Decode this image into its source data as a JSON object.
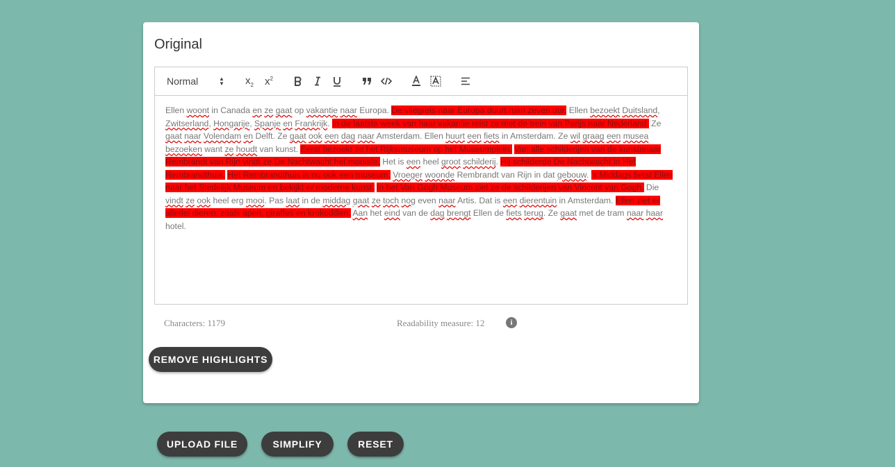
{
  "card": {
    "title": "Original"
  },
  "toolbar": {
    "format_value": "Normal",
    "subscript_label": "x",
    "superscript_label": "x"
  },
  "content": {
    "segments": [
      [
        "n",
        "Ellen "
      ],
      [
        "w",
        "woont"
      ],
      [
        "n",
        " in Canada "
      ],
      [
        "w",
        "en"
      ],
      [
        "n",
        " "
      ],
      [
        "w",
        "ze"
      ],
      [
        "n",
        " "
      ],
      [
        "w",
        "gaat"
      ],
      [
        "n",
        " op "
      ],
      [
        "w",
        "vakantie"
      ],
      [
        "n",
        " "
      ],
      [
        "w",
        "naar"
      ],
      [
        "n",
        " Europa. "
      ],
      [
        "h",
        "De vliegreis naar Europa duurt ruim zeven uur."
      ],
      [
        "n",
        " Ellen "
      ],
      [
        "w",
        "bezoekt"
      ],
      [
        "n",
        " "
      ],
      [
        "w",
        "Duitsland"
      ],
      [
        "n",
        ", "
      ],
      [
        "w",
        "Zwitserland"
      ],
      [
        "n",
        ", "
      ],
      [
        "w",
        "Hongarije"
      ],
      [
        "n",
        ", "
      ],
      [
        "w",
        "Spanje"
      ],
      [
        "n",
        " "
      ],
      [
        "w",
        "en"
      ],
      [
        "n",
        " "
      ],
      [
        "w",
        "Frankrijk"
      ],
      [
        "n",
        ". "
      ],
      [
        "h",
        "In de laatste week van haar vakantie reist ze met de trein van Parijs naar Nederland."
      ],
      [
        "n",
        " Ze "
      ],
      [
        "w",
        "gaat"
      ],
      [
        "n",
        " "
      ],
      [
        "w",
        "naar"
      ],
      [
        "n",
        " "
      ],
      [
        "w",
        "Volendam"
      ],
      [
        "n",
        " "
      ],
      [
        "w",
        "en"
      ],
      [
        "n",
        " Delft. Ze "
      ],
      [
        "w",
        "gaat"
      ],
      [
        "n",
        " "
      ],
      [
        "w",
        "ook"
      ],
      [
        "n",
        " "
      ],
      [
        "w",
        "een"
      ],
      [
        "n",
        " "
      ],
      [
        "w",
        "dag"
      ],
      [
        "n",
        " "
      ],
      [
        "w",
        "naar"
      ],
      [
        "n",
        " Amsterdam. Ellen "
      ],
      [
        "w",
        "huurt"
      ],
      [
        "n",
        " "
      ],
      [
        "w",
        "een"
      ],
      [
        "n",
        " "
      ],
      [
        "w",
        "fiets"
      ],
      [
        "n",
        " in Amsterdam. Ze "
      ],
      [
        "w",
        "wil"
      ],
      [
        "n",
        " "
      ],
      [
        "w",
        "graag"
      ],
      [
        "n",
        " "
      ],
      [
        "w",
        "een"
      ],
      [
        "n",
        " "
      ],
      [
        "w",
        "musea"
      ],
      [
        "n",
        " "
      ],
      [
        "w",
        "bezoeken"
      ],
      [
        "n",
        " want "
      ],
      [
        "w",
        "ze"
      ],
      [
        "n",
        " "
      ],
      [
        "w",
        "houdt"
      ],
      [
        "n",
        " van kunst. "
      ],
      [
        "h",
        "Eerst bezoekt ze het Rijksmuseum op het Museumplein."
      ],
      [
        "n",
        " "
      ],
      [
        "h",
        "Van alle schilderijen van de kunstenaar Rembrandt van Rijn vindt ze De Nachtwacht het mooiste."
      ],
      [
        "n",
        " Het is "
      ],
      [
        "w",
        "een"
      ],
      [
        "n",
        " heel "
      ],
      [
        "w",
        "groot"
      ],
      [
        "n",
        " "
      ],
      [
        "w",
        "schilderij"
      ],
      [
        "n",
        ". "
      ],
      [
        "h",
        "Hij schilderde De Nachtwacht in Het Rembrandthuis."
      ],
      [
        "n",
        " "
      ],
      [
        "h",
        "Het Rembrandthuis is nu ook een museum."
      ],
      [
        "n",
        " "
      ],
      [
        "w",
        "Vroeger"
      ],
      [
        "n",
        " "
      ],
      [
        "w",
        "woonde"
      ],
      [
        "n",
        " Rembrandt van Rijn in dat "
      ],
      [
        "w",
        "gebouw"
      ],
      [
        "n",
        ". "
      ],
      [
        "h",
        "'s Middags fietst Ellen naar het Stedelijk Museum en bekijkt er moderne kunst."
      ],
      [
        "n",
        " "
      ],
      [
        "h",
        "In het Van Gogh Museum ziet ze de schilderijen van Vincent van Gogh."
      ],
      [
        "n",
        " Die "
      ],
      [
        "w",
        "vindt"
      ],
      [
        "n",
        " "
      ],
      [
        "w",
        "ze"
      ],
      [
        "n",
        " "
      ],
      [
        "w",
        "ook"
      ],
      [
        "n",
        " heel erg "
      ],
      [
        "w",
        "mooi"
      ],
      [
        "n",
        ". Pas "
      ],
      [
        "w",
        "laat"
      ],
      [
        "n",
        " in de "
      ],
      [
        "w",
        "middag"
      ],
      [
        "n",
        " "
      ],
      [
        "w",
        "gaat"
      ],
      [
        "n",
        " "
      ],
      [
        "w",
        "ze"
      ],
      [
        "n",
        " "
      ],
      [
        "w",
        "toch"
      ],
      [
        "n",
        " "
      ],
      [
        "w",
        "nog"
      ],
      [
        "n",
        " even "
      ],
      [
        "w",
        "naar"
      ],
      [
        "n",
        " Artis. Dat is "
      ],
      [
        "w",
        "een"
      ],
      [
        "n",
        " "
      ],
      [
        "w",
        "dierentuin"
      ],
      [
        "n",
        " in Amsterdam. "
      ],
      [
        "h",
        "Ellen ziet er allerlei dieren, zoals apen, giraffes en krokodillen."
      ],
      [
        "n",
        " "
      ],
      [
        "w",
        "Aan"
      ],
      [
        "n",
        " het "
      ],
      [
        "w",
        "eind"
      ],
      [
        "n",
        " van de "
      ],
      [
        "w",
        "dag"
      ],
      [
        "n",
        " "
      ],
      [
        "w",
        "brengt"
      ],
      [
        "n",
        " Ellen de "
      ],
      [
        "w",
        "fiets"
      ],
      [
        "n",
        " "
      ],
      [
        "w",
        "terug"
      ],
      [
        "n",
        ". Ze "
      ],
      [
        "w",
        "gaat"
      ],
      [
        "n",
        " met de tram "
      ],
      [
        "w",
        "naar"
      ],
      [
        "n",
        " "
      ],
      [
        "w",
        "haar"
      ],
      [
        "n",
        " hotel."
      ]
    ]
  },
  "stats": {
    "characters": "Characters: 1179",
    "readability": "Readability measure: 12"
  },
  "buttons": {
    "remove_highlights": "REMOVE HIGHLIGHTS",
    "upload_file": "UPLOAD FILE",
    "simplify": "SIMPLIFY",
    "reset": "RESET"
  }
}
